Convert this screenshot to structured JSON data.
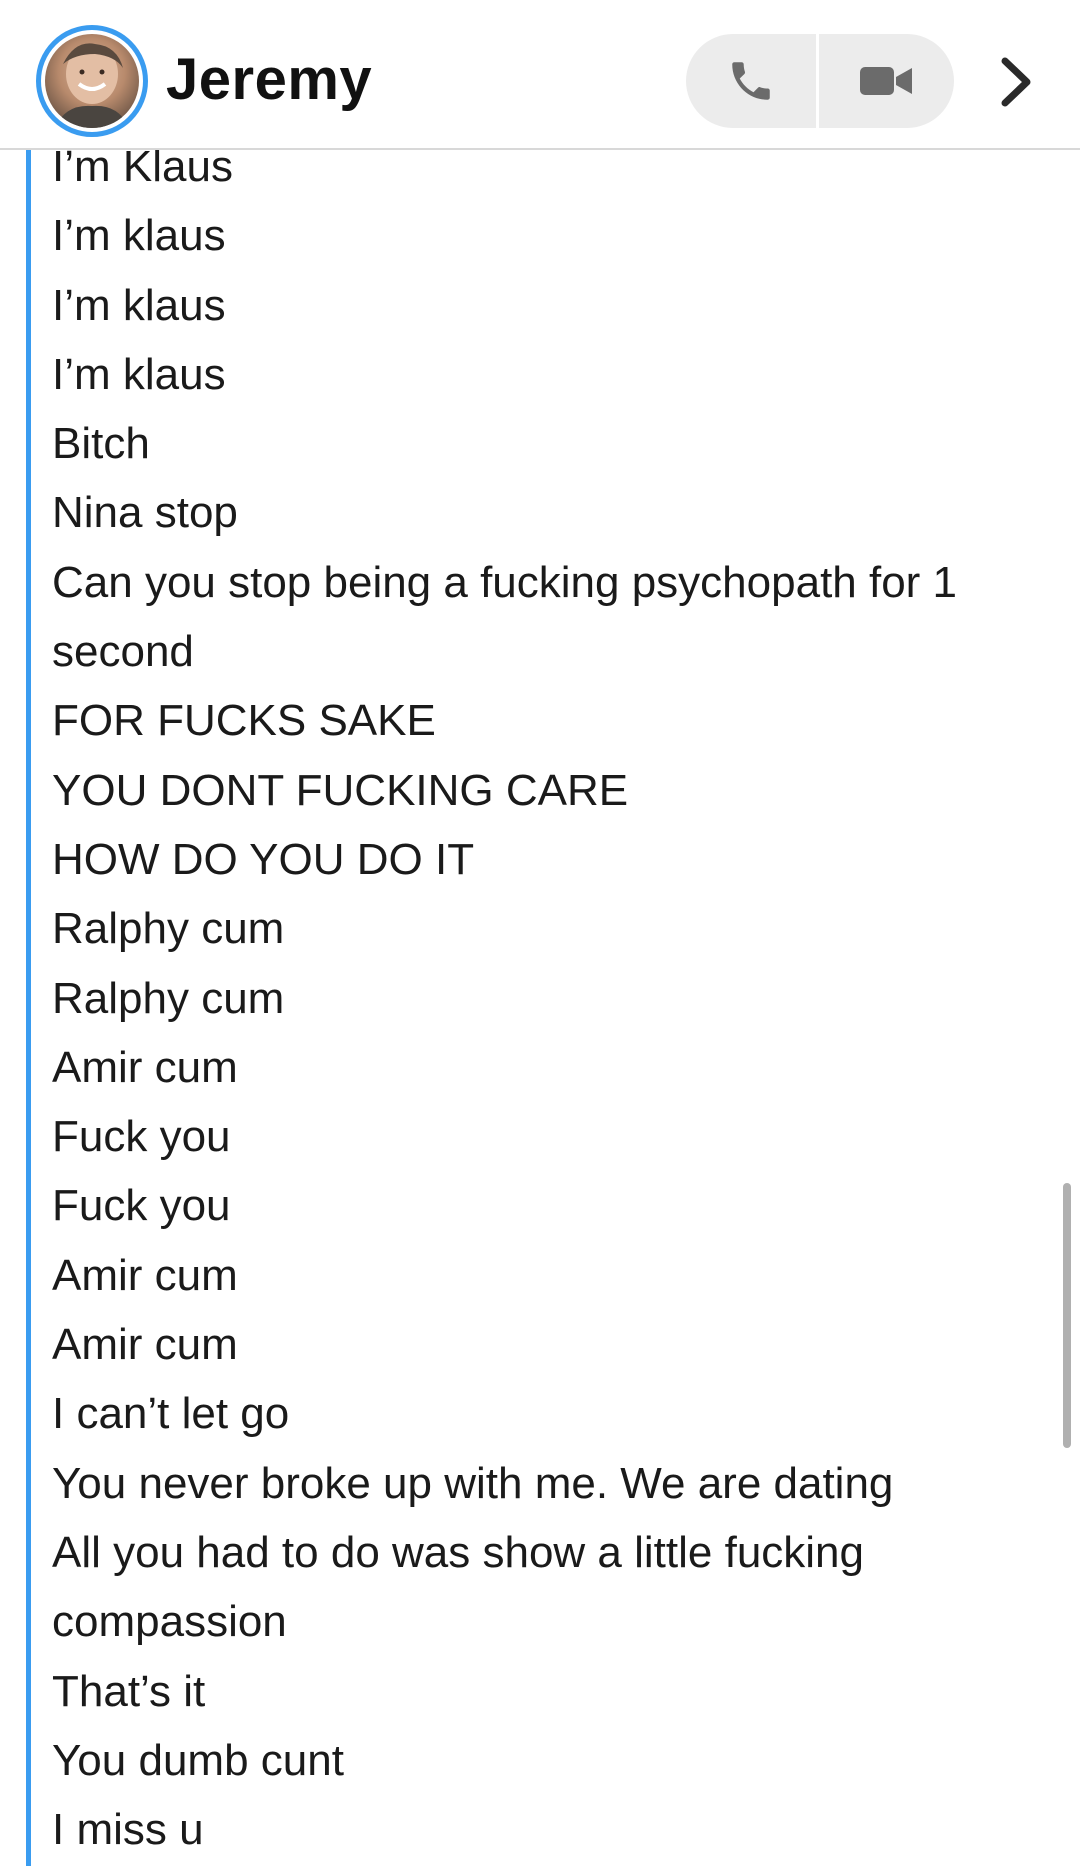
{
  "header": {
    "contact_name": "Jeremy",
    "avatar_icon": "user-avatar-photo",
    "call_icon": "phone-icon",
    "video_icon": "video-camera-icon",
    "chevron_icon": "chevron-right-icon"
  },
  "colors": {
    "accent": "#3a9cf0",
    "button_bg": "#ececec",
    "text": "#1a1a1a",
    "divider": "#d8d8d8"
  },
  "messages": [
    "I’m Klaus",
    "I’m klaus",
    "I’m klaus",
    "I’m klaus",
    "Bitch",
    "Nina stop",
    "Can you stop being a fucking psychopath for 1 second",
    "FOR FUCKS SAKE",
    "YOU DONT FUCKING CARE",
    "HOW DO YOU DO IT",
    "Ralphy cum",
    "Ralphy cum",
    "Amir cum",
    "Fuck you",
    "Fuck you",
    "Amir cum",
    "Amir cum",
    "I can’t let go",
    "You never broke up with me. We are dating",
    "All you had to do was show a little fucking compassion",
    "That’s it",
    "You dumb cunt",
    "I miss u"
  ]
}
